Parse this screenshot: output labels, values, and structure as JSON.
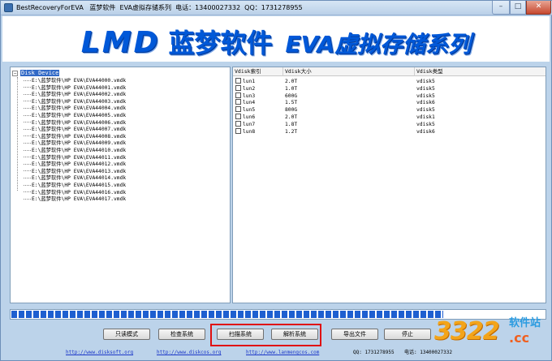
{
  "window": {
    "title": "BestRecoveryForEVA   蓝梦软件  EVA虚拟存储系列  电话：13400027332  QQ：1731278955",
    "minimize": "–",
    "maximize": "□",
    "close": "✕"
  },
  "banner": {
    "logo": "LMD",
    "company": "蓝梦软件",
    "product": "EVA虚拟存储系列",
    "color": "#0058d8"
  },
  "tree": {
    "root": "Disk Device",
    "items": [
      "E:\\蓝梦软件\\HP EVA\\EVA44000.vmdk",
      "E:\\蓝梦软件\\HP EVA\\EVA44001.vmdk",
      "E:\\蓝梦软件\\HP EVA\\EVA44002.vmdk",
      "E:\\蓝梦软件\\HP EVA\\EVA44003.vmdk",
      "E:\\蓝梦软件\\HP EVA\\EVA44004.vmdk",
      "E:\\蓝梦软件\\HP EVA\\EVA44005.vmdk",
      "E:\\蓝梦软件\\HP EVA\\EVA44006.vmdk",
      "E:\\蓝梦软件\\HP EVA\\EVA44007.vmdk",
      "E:\\蓝梦软件\\HP EVA\\EVA44008.vmdk",
      "E:\\蓝梦软件\\HP EVA\\EVA44009.vmdk",
      "E:\\蓝梦软件\\HP EVA\\EVA44010.vmdk",
      "E:\\蓝梦软件\\HP EVA\\EVA44011.vmdk",
      "E:\\蓝梦软件\\HP EVA\\EVA44012.vmdk",
      "E:\\蓝梦软件\\HP EVA\\EVA44013.vmdk",
      "E:\\蓝梦软件\\HP EVA\\EVA44014.vmdk",
      "E:\\蓝梦软件\\HP EVA\\EVA44015.vmdk",
      "E:\\蓝梦软件\\HP EVA\\EVA44016.vmdk",
      "E:\\蓝梦软件\\HP EVA\\EVA44017.vmdk"
    ]
  },
  "table": {
    "headers": [
      "Vdisk索引",
      "Vdisk大小",
      "Vdisk类型"
    ],
    "rows": [
      [
        "lun1",
        "2.0T",
        "vdisk5"
      ],
      [
        "lun2",
        "1.0T",
        "vdisk5"
      ],
      [
        "lun3",
        "600G",
        "vdisk5"
      ],
      [
        "lun4",
        "1.5T",
        "vdisk6"
      ],
      [
        "lun5",
        "800G",
        "vdisk5"
      ],
      [
        "lun6",
        "2.0T",
        "vdisk1"
      ],
      [
        "lun7",
        "1.8T",
        "vdisk5"
      ],
      [
        "lun8",
        "1.2T",
        "vdisk6"
      ]
    ]
  },
  "progress": {
    "value": 0.81,
    "color": "#1e5fd0"
  },
  "buttons": {
    "readonly": "只读模式",
    "check": "检查系统",
    "scan": "扫描系统",
    "parse": "解析系统",
    "export": "导出文件",
    "stop": "停止"
  },
  "footer": {
    "link1": "http://www.disksoft.org",
    "link2": "http://www.diskcos.org",
    "link3": "http://www.lanmengcos.com",
    "qq": "QQ: 1731278955",
    "phone": "电话: 13400027332"
  },
  "watermark": {
    "digits": "3322",
    "site": "软件站",
    "cc": ".cc"
  }
}
